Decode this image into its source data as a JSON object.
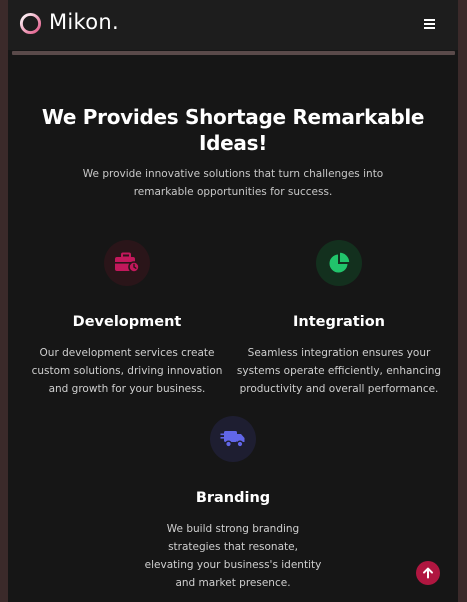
{
  "brand": {
    "name": "Mikon."
  },
  "nav": {
    "menu_icon": "hamburger-menu-icon"
  },
  "hero": {
    "title": "We Provides Shortage Remarkable Ideas!",
    "subtitle": "We provide innovative solutions that turn challenges into remarkable opportunities for success."
  },
  "services": [
    {
      "icon": "briefcase-icon",
      "icon_color": "#c2185b",
      "icon_bg": "#2a1519",
      "title": "Development",
      "text": "Our development services create custom solutions, driving innovation and growth for your business."
    },
    {
      "icon": "pie-chart-icon",
      "icon_color": "#21c46b",
      "icon_bg": "#13301e",
      "title": "Integration",
      "text": "Seamless integration ensures your systems operate efficiently, enhancing productivity and overall performance."
    },
    {
      "icon": "truck-icon",
      "icon_color": "#6166e8",
      "icon_bg": "#1e1e31",
      "title": "Branding",
      "text": "We build strong branding strategies that resonate, elevating your business's identity and market presence."
    }
  ],
  "scroll_top": {
    "icon": "arrow-up-icon",
    "color": "#b01640"
  }
}
